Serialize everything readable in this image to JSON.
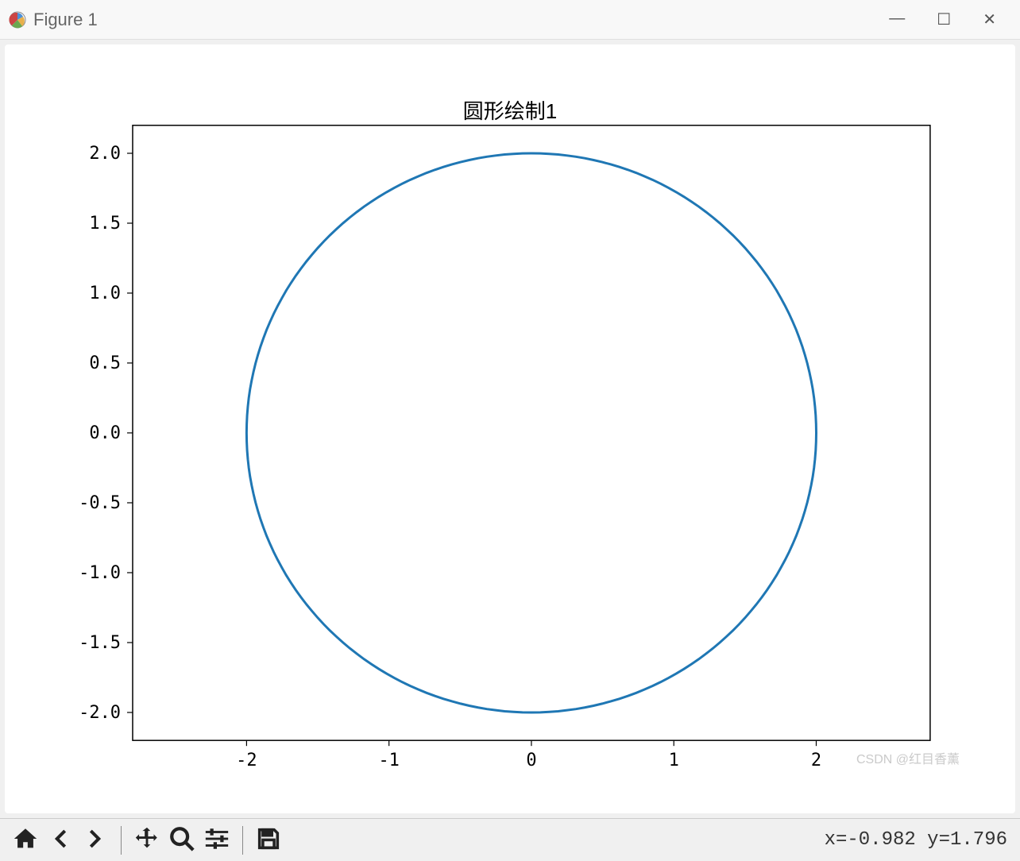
{
  "window": {
    "title": "Figure 1",
    "controls": {
      "min": "—",
      "max": "☐",
      "close": "✕"
    }
  },
  "chart_data": {
    "type": "line",
    "title": "圆形绘制1",
    "circle": {
      "cx": 0,
      "cy": 0,
      "r": 2
    },
    "xlim": [
      -2.8,
      2.8
    ],
    "ylim": [
      -2.2,
      2.2
    ],
    "xticks_labels": [
      "-2",
      "-1",
      "0",
      "1",
      "2"
    ],
    "xticks_values": [
      -2,
      -1,
      0,
      1,
      2
    ],
    "yticks_labels": [
      "2.0",
      "1.5",
      "1.0",
      "0.5",
      "0.0",
      "-0.5",
      "-1.0",
      "-1.5",
      "-2.0"
    ],
    "yticks_values": [
      2.0,
      1.5,
      1.0,
      0.5,
      0.0,
      -0.5,
      -1.0,
      -1.5,
      -2.0
    ],
    "line_color": "#1f77b4",
    "axis_color": "#000000"
  },
  "toolbar": {
    "home_label": "Home",
    "back_label": "Back",
    "forward_label": "Forward",
    "pan_label": "Pan",
    "zoom_label": "Zoom",
    "configure_label": "Configure",
    "save_label": "Save"
  },
  "cursor": {
    "text": "x=-0.982 y=1.796"
  },
  "watermark": "CSDN @红目香薰"
}
